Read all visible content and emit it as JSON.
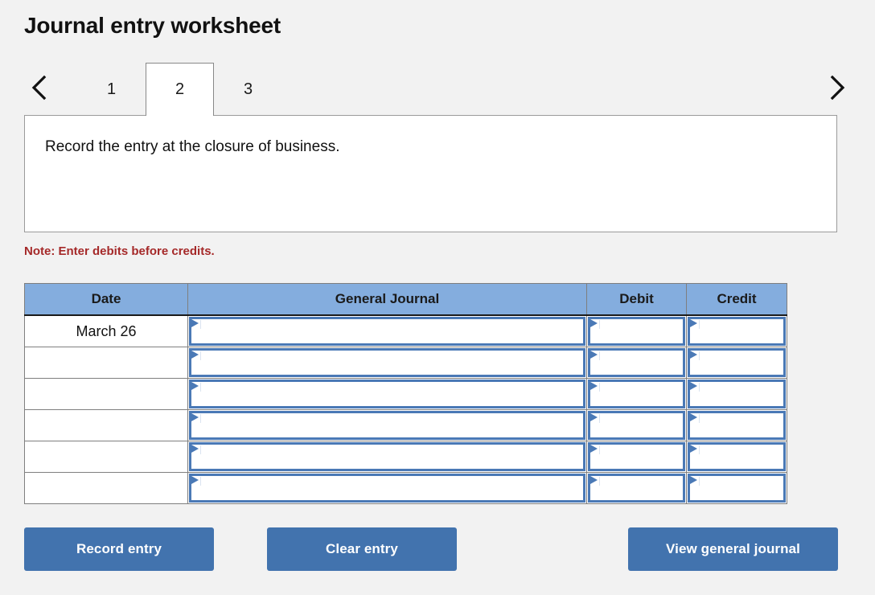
{
  "page": {
    "title": "Journal entry worksheet"
  },
  "tab_nav": {
    "prev_icon": "chevron-left-icon",
    "next_icon": "chevron-right-icon",
    "tabs": [
      {
        "label": "1",
        "active": false
      },
      {
        "label": "2",
        "active": true
      },
      {
        "label": "3",
        "active": false
      }
    ]
  },
  "panel": {
    "instruction": "Record the entry at the closure of business."
  },
  "note": {
    "text": "Note: Enter debits before credits.",
    "color": "#a52929"
  },
  "table": {
    "headers": {
      "date": "Date",
      "general_journal": "General Journal",
      "debit": "Debit",
      "credit": "Credit"
    },
    "header_bg": "#84ADDE",
    "input_border": "#4a79b6",
    "rows": [
      {
        "date": "March 26",
        "general_journal": "",
        "debit": "",
        "credit": ""
      },
      {
        "date": "",
        "general_journal": "",
        "debit": "",
        "credit": ""
      },
      {
        "date": "",
        "general_journal": "",
        "debit": "",
        "credit": ""
      },
      {
        "date": "",
        "general_journal": "",
        "debit": "",
        "credit": ""
      },
      {
        "date": "",
        "general_journal": "",
        "debit": "",
        "credit": ""
      },
      {
        "date": "",
        "general_journal": "",
        "debit": "",
        "credit": ""
      }
    ]
  },
  "buttons": {
    "record": "Record entry",
    "clear": "Clear entry",
    "view": "View general journal",
    "bg": "#4273ae"
  }
}
